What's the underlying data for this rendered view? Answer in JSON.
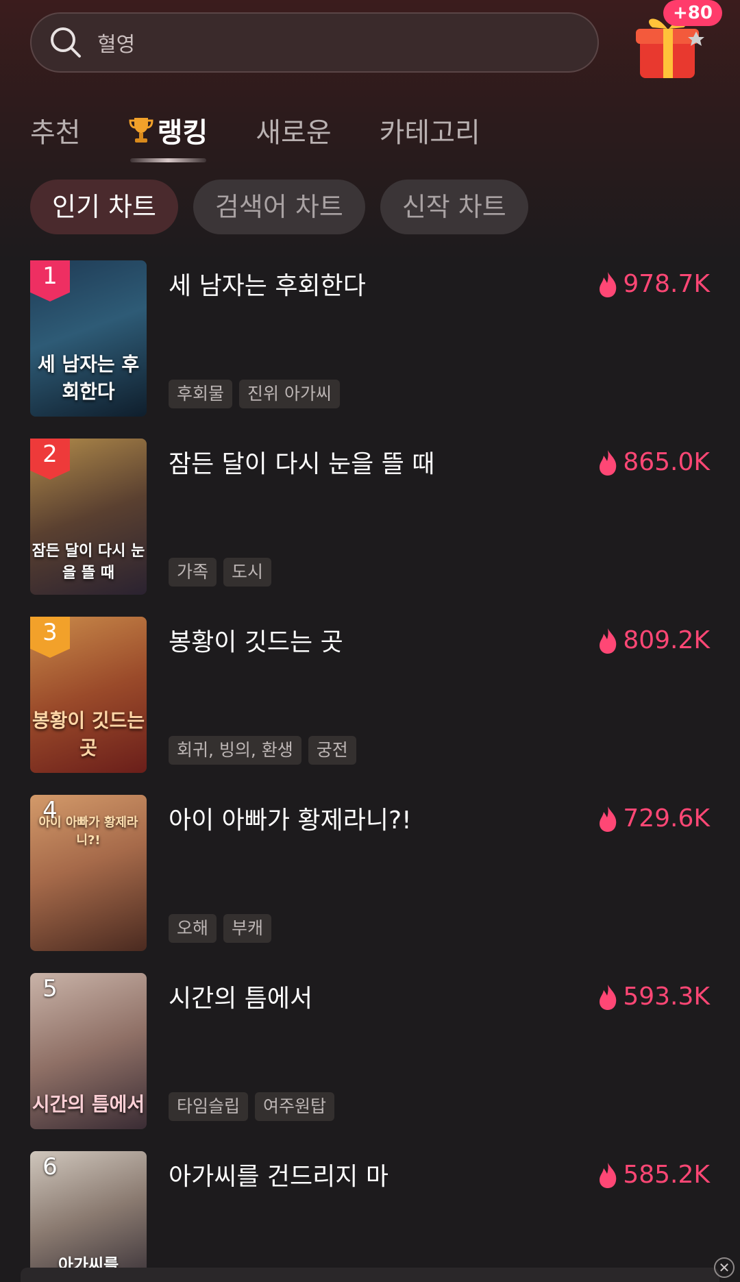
{
  "search": {
    "placeholder": "혈영",
    "icon": "search-icon"
  },
  "gift": {
    "badge": "+80",
    "icon": "gift-box-icon"
  },
  "tabs": [
    {
      "label": "추천",
      "active": false
    },
    {
      "label": "랭킹",
      "active": true,
      "icon": "trophy-icon"
    },
    {
      "label": "새로운",
      "active": false
    },
    {
      "label": "카테고리",
      "active": false
    }
  ],
  "chips": [
    {
      "label": "인기 차트",
      "active": true
    },
    {
      "label": "검색어 차트",
      "active": false
    },
    {
      "label": "신작 차트",
      "active": false
    }
  ],
  "colors": {
    "accent": "#ff4775",
    "rank1": "#ee2f62",
    "rank2": "#ee3a3a",
    "rank3": "#f2a12a"
  },
  "items": [
    {
      "rank": "1",
      "title": "세 남자는 후회한다",
      "views": "978.7K",
      "tags": [
        "후회물",
        "진위 아가씨"
      ],
      "poster_text": "세 남자는 후회한다"
    },
    {
      "rank": "2",
      "title": "잠든 달이 다시 눈을 뜰 때",
      "views": "865.0K",
      "tags": [
        "가족",
        "도시"
      ],
      "poster_text": "잠든 달이 다시 눈을 뜰 때"
    },
    {
      "rank": "3",
      "title": "봉황이 깃드는 곳",
      "views": "809.2K",
      "tags": [
        "회귀, 빙의, 환생",
        "궁전"
      ],
      "poster_text": "봉황이 깃드는 곳"
    },
    {
      "rank": "4",
      "title": "아이 아빠가 황제라니?!",
      "views": "729.6K",
      "tags": [
        "오해",
        "부캐"
      ],
      "poster_text": "아이 아빠가 황제라니?!"
    },
    {
      "rank": "5",
      "title": "시간의 틈에서",
      "views": "593.3K",
      "tags": [
        "타임슬립",
        "여주원탑"
      ],
      "poster_text": "시간의 틈에서"
    },
    {
      "rank": "6",
      "title": "아가씨를 건드리지 마",
      "views": "585.2K",
      "tags": [],
      "poster_text": "아가씨를"
    }
  ]
}
